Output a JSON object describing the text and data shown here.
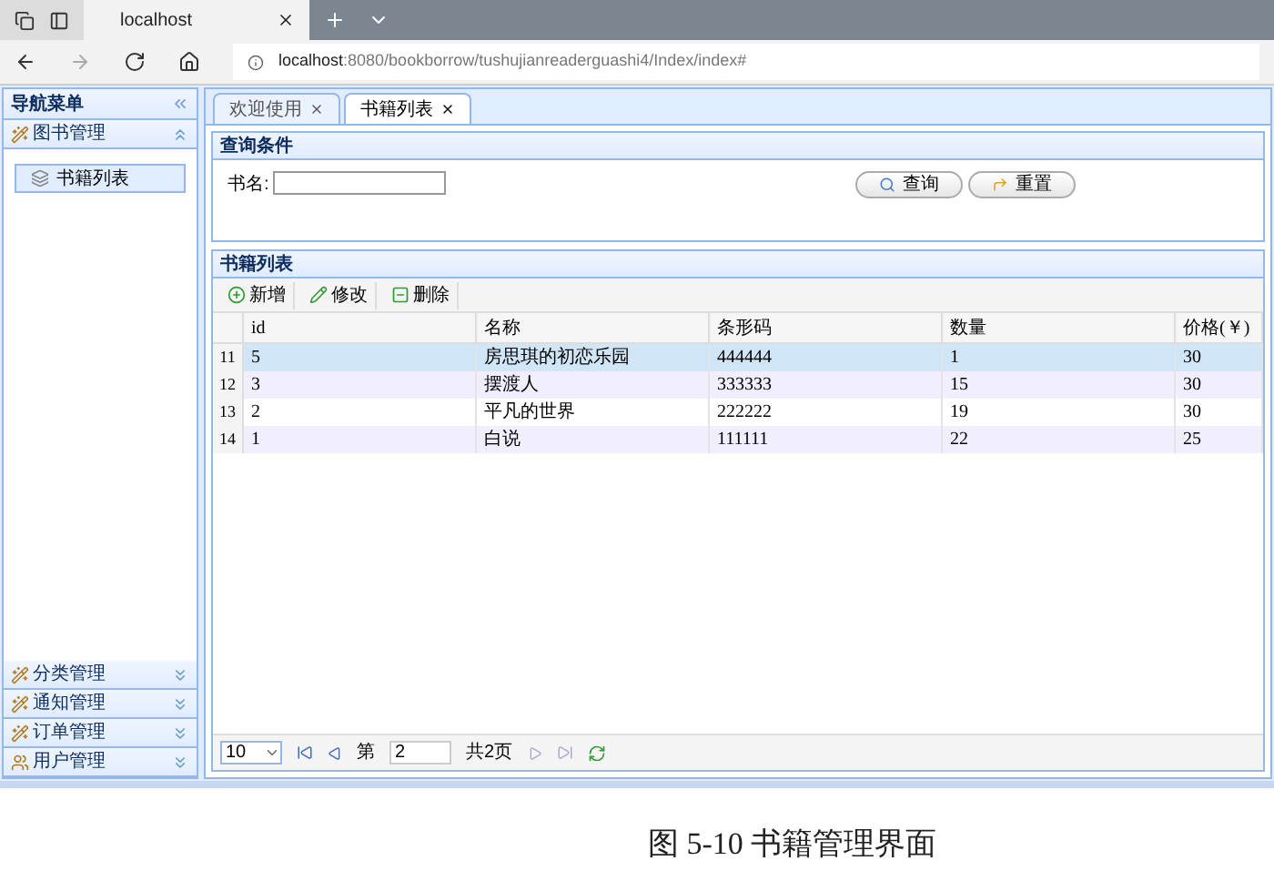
{
  "browser": {
    "tab_title": "localhost",
    "address_host": "localhost",
    "address_rest": ":8080/bookborrow/tushujianreaderguashi4/Index/index#"
  },
  "sidebar": {
    "title": "导航菜单",
    "sections": [
      {
        "label": "图书管理",
        "expanded": true,
        "kind": "tool",
        "items": [
          {
            "label": "书籍列表",
            "selected": true
          }
        ]
      },
      {
        "label": "分类管理",
        "expanded": false,
        "kind": "tool"
      },
      {
        "label": "通知管理",
        "expanded": false,
        "kind": "tool"
      },
      {
        "label": "订单管理",
        "expanded": false,
        "kind": "tool"
      },
      {
        "label": "用户管理",
        "expanded": false,
        "kind": "users"
      }
    ]
  },
  "tabs": [
    {
      "label": "欢迎使用",
      "selected": false
    },
    {
      "label": "书籍列表",
      "selected": true
    }
  ],
  "query": {
    "title": "查询条件",
    "field_label": "书名:",
    "buttons": [
      {
        "label": "查询",
        "kind": "search"
      },
      {
        "label": "重置",
        "kind": "reset"
      }
    ]
  },
  "grid": {
    "title": "书籍列表",
    "toolbar": [
      {
        "label": "新增",
        "kind": "add"
      },
      {
        "label": "修改",
        "kind": "edit"
      },
      {
        "label": "删除",
        "kind": "remove"
      }
    ],
    "columns": [
      "id",
      "名称",
      "条形码",
      "数量",
      "价格(￥)"
    ],
    "rows": [
      {
        "number": "11",
        "selected": true,
        "cells": [
          "5",
          "房思琪的初恋乐园",
          "444444",
          "1",
          "30"
        ]
      },
      {
        "number": "12",
        "selected": false,
        "cells": [
          "3",
          "摆渡人",
          "333333",
          "15",
          "30"
        ]
      },
      {
        "number": "13",
        "selected": false,
        "cells": [
          "2",
          "平凡的世界",
          "222222",
          "19",
          "30"
        ]
      },
      {
        "number": "14",
        "selected": false,
        "cells": [
          "1",
          "白说",
          "111111",
          "22",
          "25"
        ]
      }
    ]
  },
  "pager": {
    "page_size": "10",
    "before_page": "第",
    "page": "2",
    "total": "共2页"
  },
  "caption": "图 5-10 书籍管理界面"
}
